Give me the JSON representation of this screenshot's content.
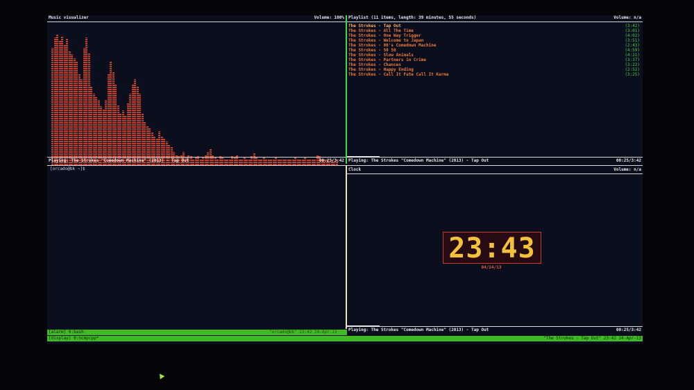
{
  "visualizer": {
    "title": "Music visualizer",
    "volume": "Volume: 100%",
    "status": "Playing: The Strokes \"Comedown Machine\" (2013) - Tap Out",
    "time": "00:25/3:42",
    "bar_levels": [
      0.9,
      0.98,
      1.0,
      0.95,
      0.99,
      0.92,
      0.97,
      0.88,
      0.85,
      0.82,
      0.8,
      0.7,
      0.66,
      0.9,
      0.98,
      0.86,
      0.6,
      0.55,
      0.52,
      0.5,
      0.45,
      0.43,
      0.5,
      0.7,
      0.8,
      0.72,
      0.62,
      0.46,
      0.4,
      0.42,
      0.38,
      0.48,
      0.55,
      0.62,
      0.66,
      0.6,
      0.55,
      0.4,
      0.33,
      0.3,
      0.28,
      0.25,
      0.22,
      0.2,
      0.26,
      0.22,
      0.2,
      0.18,
      0.16,
      0.14,
      0.1,
      0.08,
      0.07,
      0.08,
      0.1,
      0.06,
      0.08,
      0.07,
      0.05,
      0.06,
      0.07,
      0.05,
      0.06,
      0.08,
      0.1,
      0.12,
      0.08,
      0.06,
      0.05,
      0.07,
      0.06,
      0.05,
      0.04,
      0.05,
      0.07,
      0.06,
      0.08,
      0.05,
      0.04,
      0.06,
      0.05,
      0.04,
      0.07,
      0.09,
      0.06,
      0.05,
      0.04,
      0.06,
      0.05,
      0.04,
      0.05,
      0.04,
      0.06,
      0.05,
      0.04,
      0.05,
      0.04,
      0.05,
      0.04,
      0.05,
      0.06,
      0.04,
      0.05,
      0.04,
      0.06,
      0.05,
      0.04,
      0.04,
      0.05,
      0.08,
      0.07,
      0.05,
      0.04,
      0.04,
      0.03,
      0.04,
      0.03,
      0.04
    ]
  },
  "playlist": {
    "title": "Playlist (11 items, length: 39 minutes, 55 seconds)",
    "volume": "Volume: n/a",
    "tracks": [
      {
        "title": "The Strokes - Tap Out",
        "duration": "(3:42)"
      },
      {
        "title": "The Strokes - All The Time",
        "duration": "(3:01)"
      },
      {
        "title": "The Strokes - One Way Trigger",
        "duration": "(4:02)"
      },
      {
        "title": "The Strokes - Welcome to Japan",
        "duration": "(3:51)"
      },
      {
        "title": "The Strokes - 80's Comedown Machine",
        "duration": "(2:43)"
      },
      {
        "title": "The Strokes - 50 50",
        "duration": "(4:59)"
      },
      {
        "title": "The Strokes - Slow Animals",
        "duration": "(4:21)"
      },
      {
        "title": "The Strokes - Partners in Crime",
        "duration": "(3:37)"
      },
      {
        "title": "The Strokes - Chances",
        "duration": "(3:22)"
      },
      {
        "title": "The Strokes - Happy Ending",
        "duration": "(2:52)"
      },
      {
        "title": "The Strokes - Call It Fate Call It Karma",
        "duration": "(3:25)"
      }
    ],
    "status": "Playing: The Strokes \"Comedown Machine\" (2013) - Tap Out",
    "time": "00:25/3:42"
  },
  "shell": {
    "prompt": "[orcado@bk ~]$"
  },
  "clock": {
    "title": "Clock",
    "volume": "Volume: n/a",
    "time": "23:43",
    "date": "04/24/13",
    "status": "Playing: The Strokes \"Comedown Machine\" (2013) - Tap Out",
    "elapsed": "00:25/3:42"
  },
  "tmux": {
    "line1": "[alarm] 0:bash-",
    "line2": "[display] 0:ncmpcpp*",
    "center": "\"orcado@bk\" 23:42 24-Apr-13",
    "right": "\"The Strokes - Tap Out\" 23:42 24-Apr-13"
  },
  "colors": {
    "accent_green": "#3fb925",
    "visualizer_bar": "#c3402a",
    "clock_digits": "#f4c23a",
    "clock_border": "#d03a2a",
    "duration": "#3fd94a"
  },
  "progress": {
    "fraction": 0.11
  }
}
